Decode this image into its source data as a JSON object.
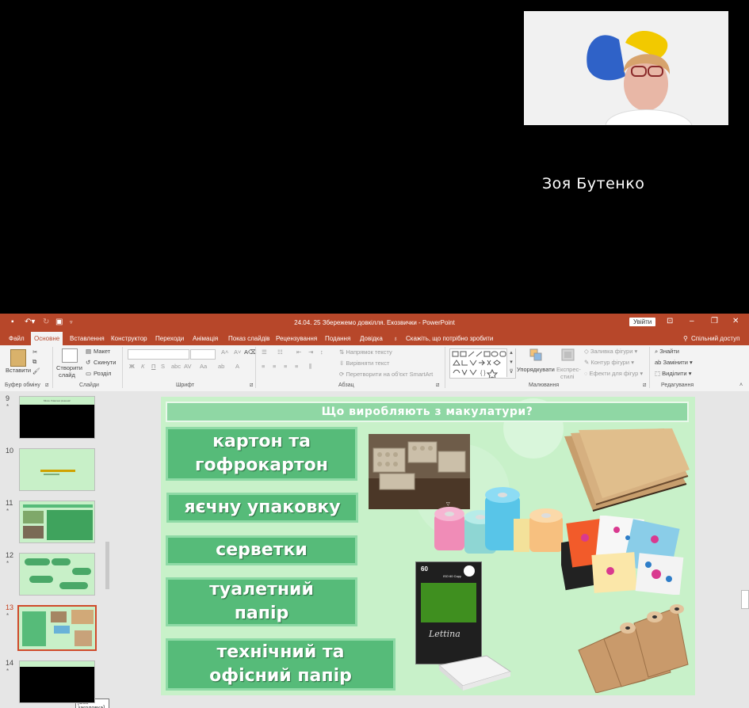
{
  "video": {
    "participant_name": "Зоя Бутенко"
  },
  "window": {
    "title": "24.04. 25 Збережемо довкілля. Екозвички  -  PowerPoint",
    "sign_in": "Увійти",
    "controls": [
      "minimize-icon",
      "maximize-icon",
      "close-icon"
    ]
  },
  "tabs": {
    "items": [
      "Файл",
      "Основне",
      "Вставлення",
      "Конструктор",
      "Переходи",
      "Анімація",
      "Показ слайдів",
      "Рецензування",
      "Подання",
      "Довідка"
    ],
    "active": "Основне",
    "tell_me": "Скажіть, що потрібно зробити",
    "share": "Спільний доступ"
  },
  "ribbon": {
    "clipboard": {
      "paste": "Вставити",
      "label": "Буфер обміну"
    },
    "slides": {
      "new_slide": "Створити",
      "new_slide_2": "слайд",
      "layout": "Макет",
      "reset": "Скинути",
      "section": "Розділ",
      "label": "Слайди"
    },
    "font": {
      "label": "Шрифт",
      "bold": "Ж",
      "italic": "К",
      "underline": "П",
      "strike": "S",
      "abc": "abc",
      "spacing": "AV",
      "case": "Aa"
    },
    "paragraph": {
      "label": "Абзац",
      "text_direction": "Напрямок тексту",
      "align_text": "Вирівняти текст",
      "smartart": "Перетворити на об'єкт SmartArt"
    },
    "drawing": {
      "arrange": "Упорядкувати",
      "quick_styles": "Експрес-",
      "quick_styles_2": "стилі",
      "fill": "Заливка фігури",
      "outline": "Контур фігури",
      "effects": "Ефекти для фігур",
      "label": "Малювання"
    },
    "editing": {
      "find": "Знайти",
      "replace": "Замінити",
      "select": "Виділити",
      "label": "Редагування"
    }
  },
  "thumbnails": [
    {
      "number": "9",
      "star": "*",
      "style": "black",
      "caption": "Misce Ухвалені рішення!"
    },
    {
      "number": "10",
      "star": "",
      "style": "green",
      "caption": ""
    },
    {
      "number": "11",
      "star": "*",
      "style": "green",
      "caption": ""
    },
    {
      "number": "12",
      "star": "*",
      "style": "green",
      "caption": ""
    },
    {
      "number": "13",
      "star": "*",
      "style": "green-selected",
      "caption": ""
    },
    {
      "number": "14",
      "star": "*",
      "style": "black",
      "caption": ""
    }
  ],
  "tooltip": "[Без заголовка]",
  "slide": {
    "title": "Що виробляють з макулатури?",
    "items": [
      {
        "line1": "картон та",
        "line2": "гофрокартон"
      },
      {
        "line1": "яєчну упаковку",
        "line2": ""
      },
      {
        "line1": "серветки",
        "line2": ""
      },
      {
        "line1": "туалетний",
        "line2": "папір"
      },
      {
        "line1": "технічний та",
        "line2": "офісний папір"
      }
    ],
    "paper_pack": {
      "count": "60",
      "brand": "Lettina",
      "iso": "ISO 60 Copy"
    }
  },
  "colors": {
    "ppt_accent": "#b7472a",
    "slide_bg": "#c8f1c9",
    "item_bg": "#56bb79"
  }
}
